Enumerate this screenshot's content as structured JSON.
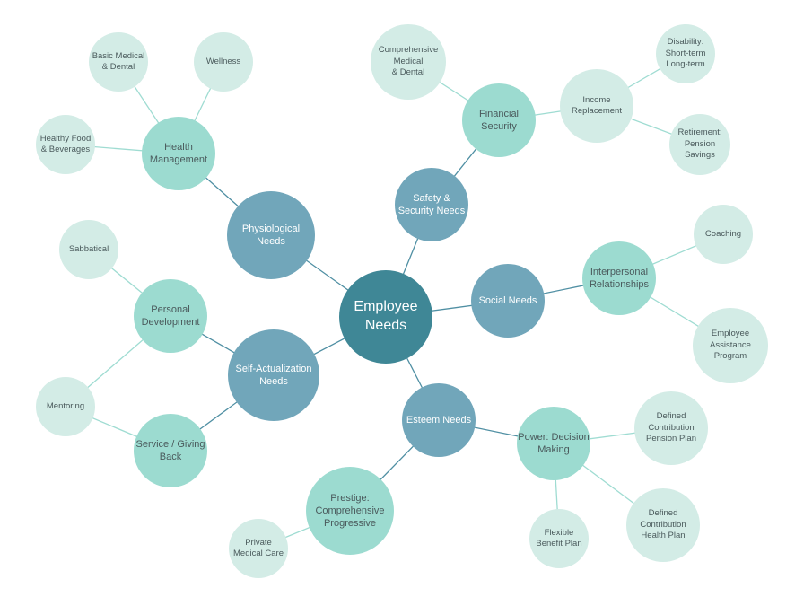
{
  "diagram": {
    "title": "Employee Needs",
    "colors": {
      "root": "#3f8796",
      "category": "#71a6ba",
      "subcategory": "#9cdbd0",
      "leaf": "#d3ece6",
      "edge_dark": "#4f8fa3",
      "edge_light": "#9fdcd2"
    },
    "nodes": [
      {
        "id": "root",
        "label": "Employee\nNeeds",
        "level": 0
      },
      {
        "id": "physiological",
        "label": "Physiological\nNeeds",
        "level": 1,
        "parent": "root"
      },
      {
        "id": "safety",
        "label": "Safety &\nSecurity Needs",
        "level": 1,
        "parent": "root"
      },
      {
        "id": "social",
        "label": "Social Needs",
        "level": 1,
        "parent": "root"
      },
      {
        "id": "esteem",
        "label": "Esteem Needs",
        "level": 1,
        "parent": "root"
      },
      {
        "id": "self",
        "label": "Self-Actualization\nNeeds",
        "level": 1,
        "parent": "root"
      },
      {
        "id": "health",
        "label": "Health\nManagement",
        "level": 2,
        "parent": "physiological"
      },
      {
        "id": "financial",
        "label": "Financial\nSecurity",
        "level": 2,
        "parent": "safety"
      },
      {
        "id": "income",
        "label": "Income\nReplacement",
        "level": 3,
        "parent": "financial"
      },
      {
        "id": "interpersonal",
        "label": "Interpersonal\nRelationships",
        "level": 2,
        "parent": "social"
      },
      {
        "id": "power",
        "label": "Power: Decision\nMaking",
        "level": 2,
        "parent": "esteem"
      },
      {
        "id": "prestige",
        "label": "Prestige:\nComprehensive\nProgressive",
        "level": 2,
        "parent": "esteem"
      },
      {
        "id": "personal",
        "label": "Personal\nDevelopment",
        "level": 2,
        "parent": "self"
      },
      {
        "id": "service",
        "label": "Service / Giving\nBack",
        "level": 2,
        "parent": "self"
      },
      {
        "id": "basic_med",
        "label": "Basic Medical\n& Dental",
        "level": 3,
        "parent": "health"
      },
      {
        "id": "wellness",
        "label": "Wellness",
        "level": 3,
        "parent": "health"
      },
      {
        "id": "food",
        "label": "Healthy Food\n& Beverages",
        "level": 3,
        "parent": "health"
      },
      {
        "id": "comp_med",
        "label": "Comprehensive\nMedical\n& Dental",
        "level": 3,
        "parent": "financial"
      },
      {
        "id": "disability",
        "label": "Disability:\nShort-term\nLong-term",
        "level": 3,
        "parent": "income"
      },
      {
        "id": "retirement",
        "label": "Retirement:\nPension\nSavings",
        "level": 3,
        "parent": "income"
      },
      {
        "id": "coaching",
        "label": "Coaching",
        "level": 3,
        "parent": "interpersonal"
      },
      {
        "id": "eap",
        "label": "Employee\nAssistance\nProgram",
        "level": 3,
        "parent": "interpersonal"
      },
      {
        "id": "dc_pension",
        "label": "Defined\nContribution\nPension Plan",
        "level": 3,
        "parent": "power"
      },
      {
        "id": "dc_health",
        "label": "Defined\nContribution\nHealth Plan",
        "level": 3,
        "parent": "power"
      },
      {
        "id": "flexible",
        "label": "Flexible\nBenefit Plan",
        "level": 3,
        "parent": "power"
      },
      {
        "id": "private_med",
        "label": "Private\nMedical Care",
        "level": 3,
        "parent": "prestige"
      },
      {
        "id": "sabbatical",
        "label": "Sabbatical",
        "level": 3,
        "parent": "personal"
      },
      {
        "id": "mentoring",
        "label": "Mentoring",
        "level": 3,
        "parent": "personal"
      }
    ],
    "extra_edges": [
      {
        "from": "mentoring",
        "to": "service"
      }
    ]
  }
}
